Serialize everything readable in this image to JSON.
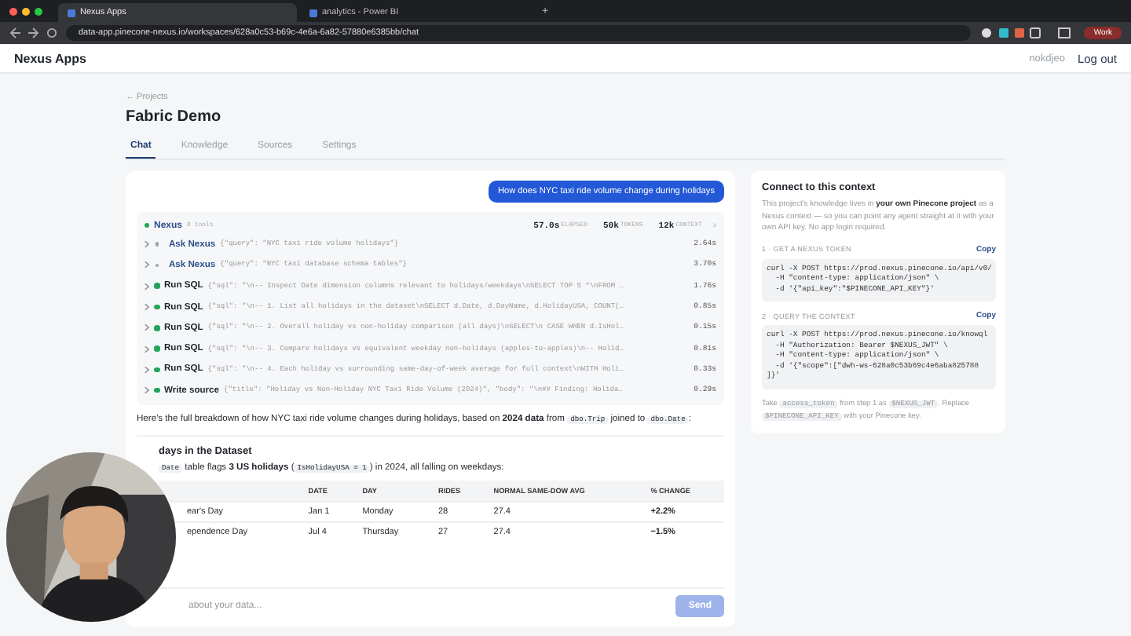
{
  "browser": {
    "tabs": [
      {
        "title": "Nexus Apps",
        "selected": true
      },
      {
        "title": "analytics - Power BI",
        "selected": false
      }
    ],
    "new_tab": "+",
    "url": "data-app.pinecone-nexus.io/workspaces/628a0c53-b69c-4e6a-6a82-57880e6385bb/chat",
    "profile": "Work"
  },
  "header": {
    "brand": "Nexus Apps",
    "user": "nokdjeo",
    "logout": "Log out"
  },
  "breadcrumb": "← Projects",
  "title": "Fabric Demo",
  "tabs": [
    {
      "label": "Chat",
      "selected": true
    },
    {
      "label": "Knowledge",
      "selected": false
    },
    {
      "label": "Sources",
      "selected": false
    },
    {
      "label": "Settings",
      "selected": false
    }
  ],
  "chat": {
    "user_message": "How does NYC taxi ride volume change during holidays",
    "agent": {
      "name": "Nexus",
      "tool_count": "8 tools",
      "stats": [
        {
          "value": "57.0s",
          "label": "ELAPSED"
        },
        {
          "value": "50k",
          "label": "TOKENS"
        },
        {
          "value": "12k",
          "label": "CONTEXT"
        }
      ],
      "expand": "›",
      "tools": [
        {
          "kind": "ask",
          "color": "#9aa3ad",
          "name": "Ask Nexus",
          "args": "{\"query\": \"NYC taxi ride volume holidays\"}",
          "time": "2.64s"
        },
        {
          "kind": "ask",
          "color": "#9aa3ad",
          "name": "Ask Nexus",
          "args": "{\"query\": \"NYC taxi database schema tables\"}",
          "time": "3.70s"
        },
        {
          "kind": "sql",
          "color": "#22a55b",
          "name": "Run SQL",
          "args": "{\"sql\": \"\\n-- Inspect Date dimension columns relevant to holidays/weekdays\\nSELECT TOP 5 *\\nFROM …",
          "time": "1.76s"
        },
        {
          "kind": "sql",
          "color": "#22a55b",
          "name": "Run SQL",
          "args": "{\"sql\": \"\\n-- 1. List all holidays in the dataset\\nSELECT d.Date, d.DayName, d.HolidayUSA, COUNT(…",
          "time": "0.85s"
        },
        {
          "kind": "sql",
          "color": "#22a55b",
          "name": "Run SQL",
          "args": "{\"sql\": \"\\n-- 2. Overall holiday vs non-holiday comparison (all days)\\nSELECT\\n CASE WHEN d.IsHol…",
          "time": "0.15s"
        },
        {
          "kind": "sql",
          "color": "#22a55b",
          "name": "Run SQL",
          "args": "{\"sql\": \"\\n-- 3. Compare holidays vs equivalent weekday non-holidays (apples-to-apples)\\n-- Holid…",
          "time": "0.81s"
        },
        {
          "kind": "sql",
          "color": "#22a55b",
          "name": "Run SQL",
          "args": "{\"sql\": \"\\n-- 4. Each holiday vs surrounding same-day-of-week average for full context\\nWITH Holi…",
          "time": "0.33s"
        },
        {
          "kind": "write",
          "color": "#22a55b",
          "name": "Write source",
          "args": "{\"title\": \"Holiday vs Non-Holiday NYC Taxi Ride Volume (2024)\", \"body\": \"\\n## Finding: Holida…",
          "time": "0.29s"
        }
      ]
    },
    "intro": [
      {
        "kind": "text",
        "text": "Here's the full breakdown of how NYC taxi ride volume changes during holidays, based on "
      },
      {
        "kind": "bold",
        "text": "2024 data"
      },
      {
        "kind": "text",
        "text": " from "
      },
      {
        "kind": "code",
        "text": "dbo.Trip"
      },
      {
        "kind": "text",
        "text": " joined to "
      },
      {
        "kind": "code",
        "text": "dbo.Date"
      },
      {
        "kind": "text",
        "text": ":"
      }
    ],
    "heading": "days in the Dataset",
    "note": [
      {
        "kind": "code",
        "text": "Date"
      },
      {
        "kind": "text",
        "text": " table flags "
      },
      {
        "kind": "bold",
        "text": "3 US holidays"
      },
      {
        "kind": "text",
        "text": " ("
      },
      {
        "kind": "code",
        "text": "IsHolidayUSA = 1"
      },
      {
        "kind": "text",
        "text": ") in 2024, all falling on weekdays:"
      }
    ],
    "table": {
      "columns": [
        "",
        "DATE",
        "DAY",
        "RIDES",
        "NORMAL SAME-DOW AVG",
        "% CHANGE"
      ],
      "rows": [
        [
          "ear's Day",
          "Jan 1",
          "Monday",
          "28",
          "27.4",
          "+2.2%"
        ],
        [
          "ependence Day",
          "Jul 4",
          "Thursday",
          "27",
          "27.4",
          "−1.5%"
        ]
      ]
    },
    "input": {
      "placeholder": "about your data...",
      "send": "Send"
    }
  },
  "connect": {
    "title": "Connect to this context",
    "description": "This project's knowledge lives in **your own Pinecone project** as a Nexus context — so you can point any agent straight at it with your own API key. No app login required.",
    "steps": [
      {
        "label": "1 · GET A NEXUS TOKEN",
        "copy": "Copy",
        "code": [
          "curl -X POST https://prod.nexus.pinecone.io/api/v0/",
          "  -H \"content-type: application/json\" \\",
          "  -d '{\"api_key\":\"$PINECONE_API_KEY\"}'"
        ]
      },
      {
        "label": "2 · QUERY THE CONTEXT",
        "copy": "Copy",
        "code": [
          "curl -X POST https://prod.nexus.pinecone.io/knowql",
          "  -H \"Authorization: Bearer $NEXUS_JWT\" \\",
          "  -H \"content-type: application/json\" \\",
          "  -d '{\"scope\":[\"dwh-ws-628a0c53b69c4e6aba825788",
          "]}'"
        ]
      }
    ],
    "footnote": [
      {
        "kind": "text",
        "text": "Take "
      },
      {
        "kind": "code",
        "text": "access_token"
      },
      {
        "kind": "text",
        "text": " from step 1 as "
      },
      {
        "kind": "code",
        "text": "$NEXUS_JWT"
      },
      {
        "kind": "text",
        "text": ". Replace "
      },
      {
        "kind": "code",
        "text": "$PINECONE_API_KEY"
      },
      {
        "kind": "text",
        "text": " with your Pinecone key."
      }
    ]
  }
}
